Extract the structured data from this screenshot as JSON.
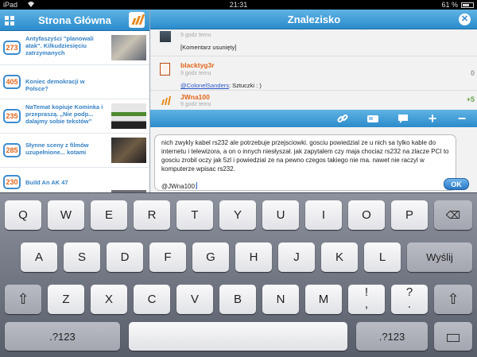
{
  "status_bar": {
    "device": "iPad",
    "time": "21:31",
    "battery": "61 %"
  },
  "left_panel": {
    "title": "Strona Główna",
    "items": [
      {
        "count": "273",
        "title": "Antyfaszyści \"planowali atak\". Kilkudziesięciu zatrzymanych"
      },
      {
        "count": "405",
        "title": "Koniec demokracji w Polsce?"
      },
      {
        "count": "235",
        "title": "NaTemat kopiuje Kominka i przepraszą. „Nie podp... dalajmy sobie tekstów”"
      },
      {
        "count": "285",
        "title": "Słynne sceny z filmów uzupełnione... kotami"
      },
      {
        "count": "230",
        "title": "Build An AK 47"
      }
    ]
  },
  "right_panel": {
    "title": "Znalezisko",
    "comments": [
      {
        "time": "9 godz temu",
        "text": "[Komentarz usunięty]"
      },
      {
        "user": "blacktyg3r",
        "time": "9 godz temu",
        "mention": "@ColonelSanders",
        "text": ": Sztuczki : )",
        "score": "0"
      },
      {
        "user": "JWna100",
        "time": "9 godz temu",
        "score": "+5"
      }
    ],
    "editor_text": "nich zwykly kabel rs232 ale potrzebuje przejsciowki. gosciu powiedzial ze u nich sa tylko kable do internetu i telewizora, a on o innych niesłyszał. jak zapytalem czy maja chociaz rs232 na zlacze PCI to gosciu zrobil oczy jak 5zl i powiedzial ze na pewno czegos takiego nie ma. nawet nie raczyl w komputerze wpisac rs232.",
    "editor_mention": "@JWna100:",
    "ok_label": "OK"
  },
  "keyboard": {
    "row1": [
      "Q",
      "W",
      "E",
      "R",
      "T",
      "Y",
      "U",
      "I",
      "O",
      "P"
    ],
    "row2": [
      "A",
      "S",
      "D",
      "F",
      "G",
      "H",
      "J",
      "K",
      "L"
    ],
    "return_label": "Wyślij",
    "row3": [
      "Z",
      "X",
      "C",
      "V",
      "B",
      "N",
      "M",
      "!",
      "?"
    ],
    "row3_sub": [
      ",",
      "."
    ],
    "numbers_label": ".?123",
    "shift_icon": "⇧",
    "delete_icon": "⌫"
  },
  "colors": {
    "accent_blue": "#2b8ccd",
    "count_orange": "#e2661b",
    "score_green": "#6aa34a"
  }
}
